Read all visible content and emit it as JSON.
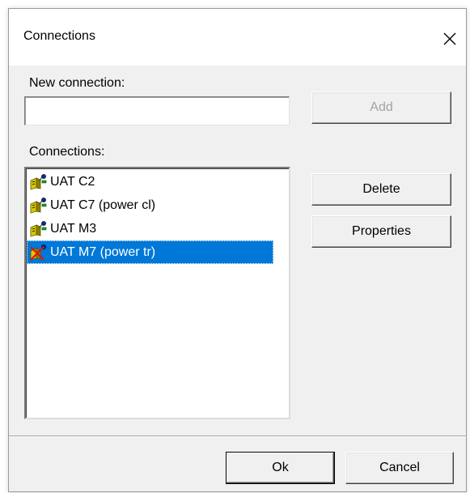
{
  "window": {
    "title": "Connections"
  },
  "new_connection": {
    "label": "New connection:",
    "value": "",
    "placeholder": ""
  },
  "buttons": {
    "add": "Add",
    "delete": "Delete",
    "properties": "Properties",
    "ok": "Ok",
    "cancel": "Cancel"
  },
  "connections": {
    "label": "Connections:",
    "items": [
      {
        "label": "UAT C2",
        "icon": "connection-icon",
        "selected": false
      },
      {
        "label": "UAT C7 (power cl)",
        "icon": "connection-icon",
        "selected": false
      },
      {
        "label": "UAT M3",
        "icon": "connection-icon",
        "selected": false
      },
      {
        "label": "UAT M7 (power tr)",
        "icon": "connection-disabled-icon",
        "selected": true
      }
    ]
  },
  "colors": {
    "selection": "#0078d7",
    "dialog_bg": "#f0f0f0",
    "disabled_text": "#a3a3a3"
  }
}
